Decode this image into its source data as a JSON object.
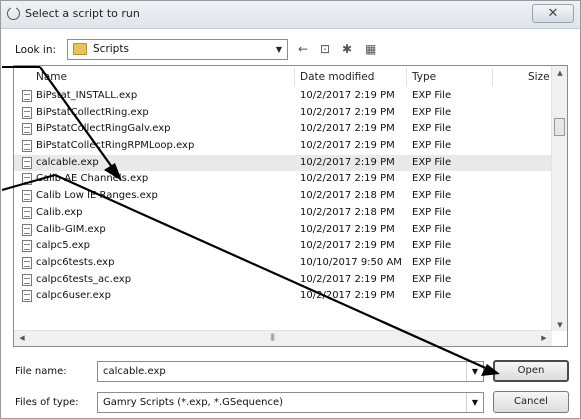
{
  "window": {
    "title": "Select a script to run",
    "close_label": "✕"
  },
  "lookin": {
    "label": "Look in:",
    "value": "Scripts"
  },
  "toolbar": {
    "back_glyph": "←",
    "up_glyph": "⊡",
    "newfolder_glyph": "✱",
    "views_glyph": "▦"
  },
  "columns": {
    "name": "Name",
    "date": "Date modified",
    "type": "Type",
    "size": "Size"
  },
  "files": [
    {
      "name": "BiPstat_INSTALL.exp",
      "date": "10/2/2017 2:19 PM",
      "type": "EXP File"
    },
    {
      "name": "BiPstatCollectRing.exp",
      "date": "10/2/2017 2:19 PM",
      "type": "EXP File"
    },
    {
      "name": "BiPstatCollectRingGalv.exp",
      "date": "10/2/2017 2:19 PM",
      "type": "EXP File"
    },
    {
      "name": "BiPstatCollectRingRPMLoop.exp",
      "date": "10/2/2017 2:19 PM",
      "type": "EXP File"
    },
    {
      "name": "calcable.exp",
      "date": "10/2/2017 2:19 PM",
      "type": "EXP File"
    },
    {
      "name": "Calib AE Channels.exp",
      "date": "10/2/2017 2:19 PM",
      "type": "EXP File"
    },
    {
      "name": "Calib Low IE Ranges.exp",
      "date": "10/2/2017 2:18 PM",
      "type": "EXP File"
    },
    {
      "name": "Calib.exp",
      "date": "10/2/2017 2:18 PM",
      "type": "EXP File"
    },
    {
      "name": "Calib-GIM.exp",
      "date": "10/2/2017 2:19 PM",
      "type": "EXP File"
    },
    {
      "name": "calpc5.exp",
      "date": "10/2/2017 2:19 PM",
      "type": "EXP File"
    },
    {
      "name": "calpc6tests.exp",
      "date": "10/10/2017 9:50 AM",
      "type": "EXP File"
    },
    {
      "name": "calpc6tests_ac.exp",
      "date": "10/2/2017 2:19 PM",
      "type": "EXP File"
    },
    {
      "name": "calpc6user.exp",
      "date": "10/2/2017 2:19 PM",
      "type": "EXP File"
    }
  ],
  "scroll": {
    "up": "▲",
    "down": "▼",
    "left": "◀",
    "right": "▶",
    "grip": "|||"
  },
  "filename": {
    "label": "File name:",
    "value": "calcable.exp"
  },
  "filetype": {
    "label": "Files of type:",
    "value": "Gamry Scripts (*.exp, *.GSequence)"
  },
  "buttons": {
    "open": "Open",
    "cancel": "Cancel"
  },
  "combo_arrow": "▼",
  "colors": {
    "selected_row": "#e9e9e9",
    "annotation_arrow": "#000000",
    "folder": "#e9c25b"
  }
}
